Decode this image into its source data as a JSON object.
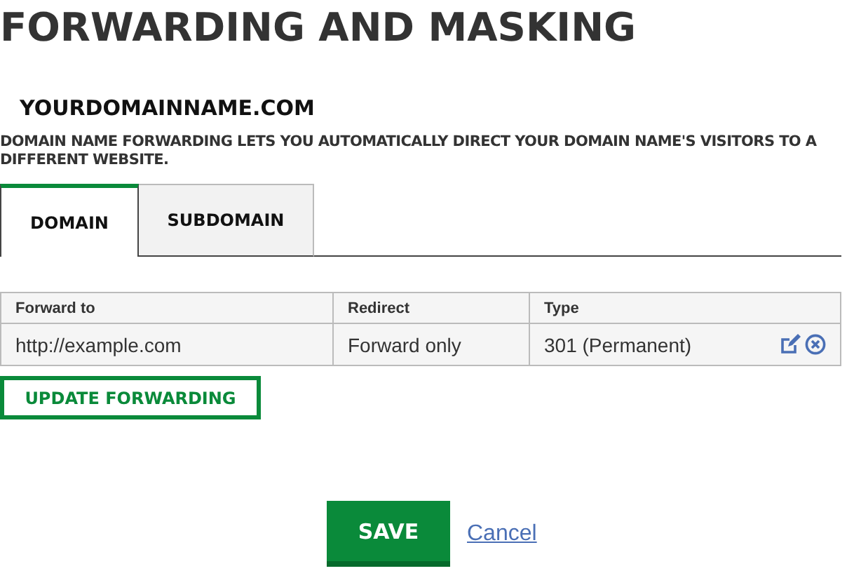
{
  "title": "FORWARDING AND MASKING",
  "domain": "YOURDOMAINNAME.COM",
  "description": "DOMAIN NAME FORWARDING LETS YOU AUTOMATICALLY DIRECT YOUR DOMAIN NAME'S VISITORS TO A DIFFERENT WEBSITE.",
  "tabs": [
    {
      "label": "DOMAIN",
      "selected": true
    },
    {
      "label": "SUBDOMAIN",
      "selected": false
    }
  ],
  "table": {
    "columns": [
      "Forward to",
      "Redirect",
      "Type"
    ],
    "rows": [
      [
        "http://example.com",
        "Forward only",
        "301 (Permanent)"
      ]
    ]
  },
  "update_button": "UPDATE FORWARDING",
  "save_button": "SAVE",
  "cancel_link": "Cancel"
}
